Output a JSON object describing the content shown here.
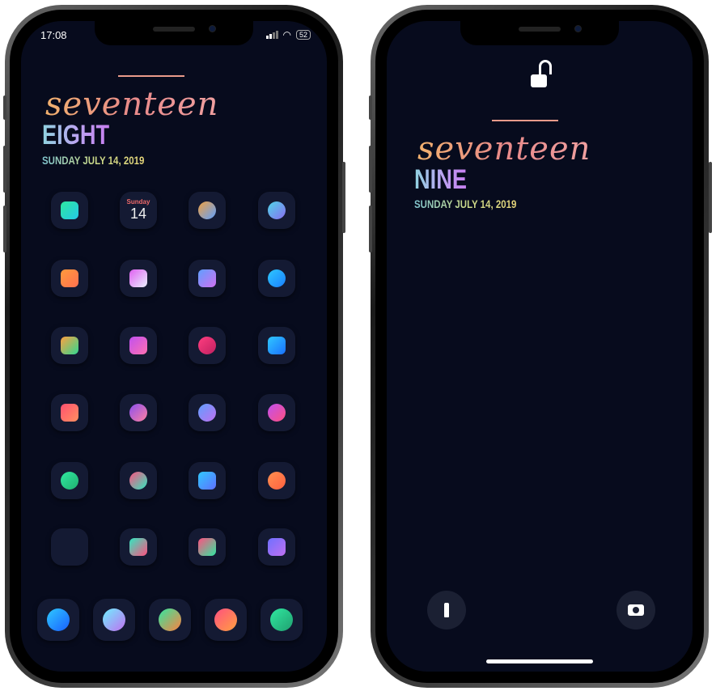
{
  "home_screen": {
    "status": {
      "time": "17:08",
      "battery": "52"
    },
    "widget": {
      "script": "seventeen",
      "hour": "EIGHT",
      "date": "SUNDAY JULY 14, 2019"
    },
    "calendar": {
      "day": "Sunday",
      "date": "14"
    },
    "apps": [
      {
        "icon": "facetime-icon",
        "colors": [
          "#2ee8a0",
          "#25c9e8"
        ]
      },
      {
        "icon": "calendar-icon",
        "colors": [
          "#fff",
          "#fff"
        ]
      },
      {
        "icon": "photos-icon",
        "colors": [
          "#f0a040",
          "#5fa0ff"
        ]
      },
      {
        "icon": "camera-icon",
        "colors": [
          "#4fd6e8",
          "#8a6df0"
        ]
      },
      {
        "icon": "notes-icon",
        "colors": [
          "#ff9a3c",
          "#ff7050"
        ]
      },
      {
        "icon": "weather-icon",
        "colors": [
          "#e060f0",
          "#e8f0ff"
        ]
      },
      {
        "icon": "maps-icon",
        "colors": [
          "#5f9fff",
          "#d070f0"
        ]
      },
      {
        "icon": "clock-icon",
        "colors": [
          "#2ec8ff",
          "#1a7fff"
        ]
      },
      {
        "icon": "reminders-icon",
        "colors": [
          "#ffa040",
          "#30d890"
        ]
      },
      {
        "icon": "tv-icon",
        "colors": [
          "#c050f0",
          "#ff70b0"
        ]
      },
      {
        "icon": "podcasts-icon",
        "colors": [
          "#ff3e80",
          "#c02060"
        ]
      },
      {
        "icon": "files-icon",
        "colors": [
          "#30c8ff",
          "#1a70ff"
        ]
      },
      {
        "icon": "health-icon",
        "colors": [
          "#ff5070",
          "#ff9060"
        ]
      },
      {
        "icon": "itunes-store-icon",
        "colors": [
          "#8a50f0",
          "#ff80a0"
        ]
      },
      {
        "icon": "app-store-icon",
        "colors": [
          "#5fa0ff",
          "#c070f0"
        ]
      },
      {
        "icon": "find-my-icon",
        "colors": [
          "#c050f0",
          "#ff5080"
        ]
      },
      {
        "icon": "activity-monitor-icon",
        "colors": [
          "#30e8a0",
          "#20b070"
        ]
      },
      {
        "icon": "activity-icon",
        "colors": [
          "#ff5080",
          "#30e8c0"
        ]
      },
      {
        "icon": "watch-icon",
        "colors": [
          "#30c8ff",
          "#5f70ff"
        ]
      },
      {
        "icon": "home-app-icon",
        "colors": [
          "#ff9050",
          "#ff6040"
        ]
      },
      {
        "icon": "folder-icon",
        "colors": [
          "#141a33",
          "#141a33"
        ]
      },
      {
        "icon": "shortcuts-icon",
        "colors": [
          "#30e8c0",
          "#ff5080"
        ]
      },
      {
        "icon": "wallet-icon",
        "colors": [
          "#ff5080",
          "#30e8a0"
        ]
      },
      {
        "icon": "settings-icon",
        "colors": [
          "#6f70ff",
          "#c070f0"
        ]
      }
    ],
    "dock": [
      {
        "icon": "safari-icon",
        "colors": [
          "#2ec8ff",
          "#1a5fff"
        ]
      },
      {
        "icon": "siri-icon",
        "colors": [
          "#6ff0ff",
          "#c070f0"
        ]
      },
      {
        "icon": "phone-icon",
        "colors": [
          "#30e8a0",
          "#ff8040"
        ]
      },
      {
        "icon": "messages-icon",
        "colors": [
          "#ff5080",
          "#ffa040"
        ]
      },
      {
        "icon": "spotify-icon",
        "colors": [
          "#30e8a0",
          "#20a070"
        ]
      }
    ]
  },
  "lock_screen": {
    "widget": {
      "script": "seventeen",
      "hour": "NINE",
      "date": "SUNDAY JULY 14, 2019"
    },
    "flashlight_icon": "🔦",
    "camera_icon": "📷",
    "lock_icon": "unlocked-padlock"
  }
}
